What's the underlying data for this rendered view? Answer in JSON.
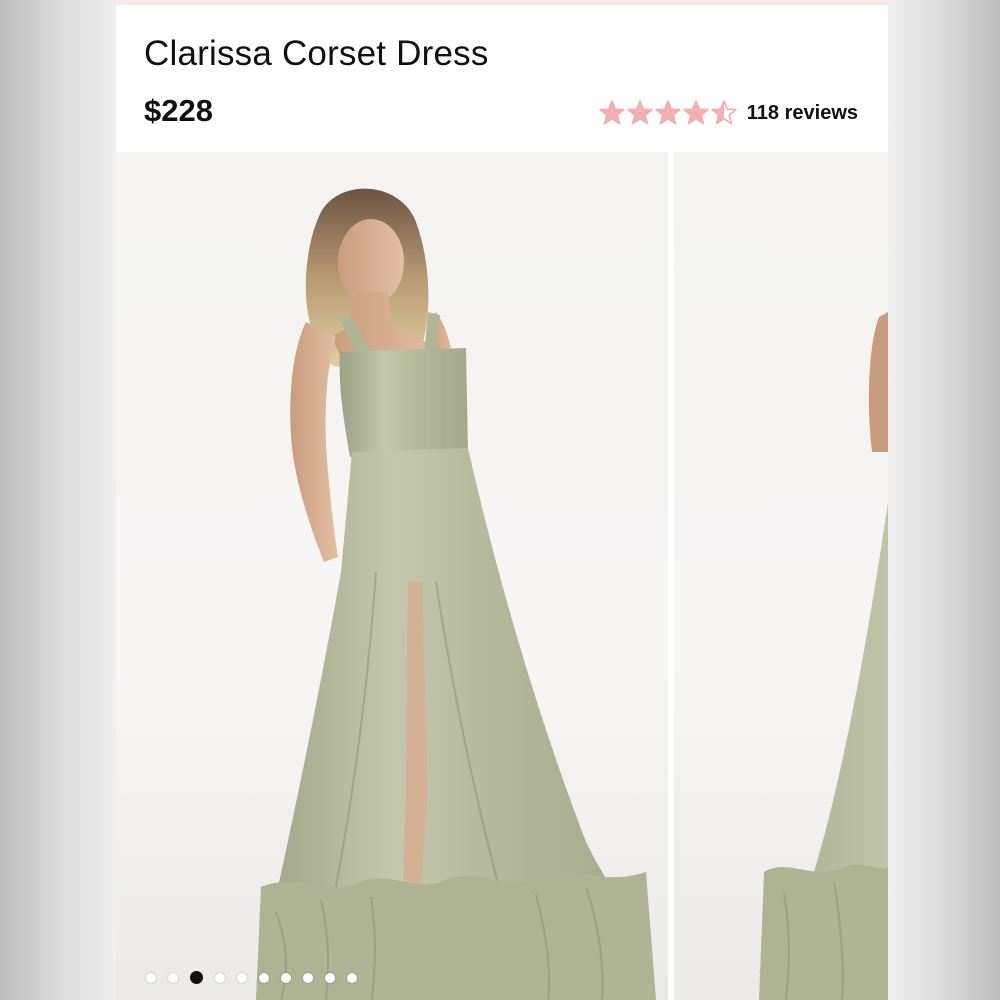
{
  "product": {
    "title": "Clarissa Corset Dress",
    "price": "$228"
  },
  "rating": {
    "value": 4.5,
    "max": 5,
    "reviews_label": "118 reviews",
    "star_color": "#f2aeb0"
  },
  "gallery": {
    "slide_count": 10,
    "active_index": 2,
    "images": [
      {
        "icon": "dress-photo-front"
      },
      {
        "icon": "dress-photo-partial"
      }
    ]
  },
  "colors": {
    "accent_strip": "#f9e7e6",
    "dress": "#b7bd9f"
  }
}
